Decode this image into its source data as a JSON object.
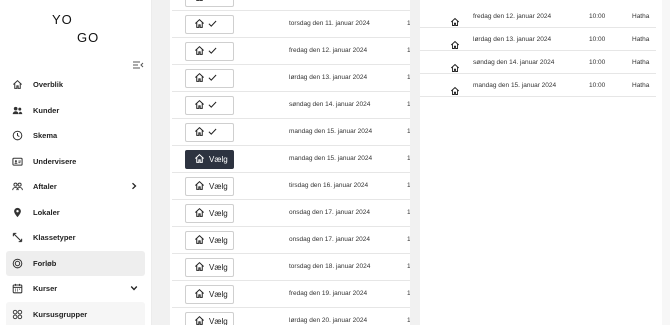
{
  "logo": {
    "line1": "YO",
    "line2": "GO"
  },
  "sidebar": {
    "items": [
      {
        "label": "Overblik",
        "icon": "home-icon"
      },
      {
        "label": "Kunder",
        "icon": "users-icon"
      },
      {
        "label": "Skema",
        "icon": "clock-icon"
      },
      {
        "label": "Undervisere",
        "icon": "id-card-icon"
      },
      {
        "label": "Aftaler",
        "icon": "people-icon",
        "chevron": "right"
      },
      {
        "label": "Lokaler",
        "icon": "location-pin-icon"
      },
      {
        "label": "Klassetyper",
        "icon": "arrows-icon"
      },
      {
        "label": "Forløb",
        "icon": "rings-icon",
        "active": true
      },
      {
        "label": "Kurser",
        "icon": "calendar-icon",
        "chevron": "down"
      },
      {
        "label": "Kursusgrupper",
        "icon": "grid-icon"
      }
    ]
  },
  "table": {
    "rows": [
      {
        "button": "check",
        "label": "",
        "date": "",
        "trail": "1"
      },
      {
        "button": "check",
        "label": "",
        "date": "torsdag den 11. januar 2024",
        "trail": "1"
      },
      {
        "button": "check",
        "label": "",
        "date": "fredag den 12. januar 2024",
        "trail": "1"
      },
      {
        "button": "check",
        "label": "",
        "date": "lørdag den 13. januar 2024",
        "trail": "1"
      },
      {
        "button": "check",
        "label": "",
        "date": "søndag den 14. januar 2024",
        "trail": "1"
      },
      {
        "button": "check",
        "label": "",
        "date": "mandag den 15. januar 2024",
        "trail": "1"
      },
      {
        "button": "dark",
        "label": "Vælg",
        "date": "mandag den 15. januar 2024",
        "trail": "1"
      },
      {
        "button": "select",
        "label": "Vælg",
        "date": "tirsdag den 16. januar 2024",
        "trail": "1"
      },
      {
        "button": "select",
        "label": "Vælg",
        "date": "onsdag den 17. januar 2024",
        "trail": "1"
      },
      {
        "button": "select",
        "label": "Vælg",
        "date": "onsdag den 17. januar 2024",
        "trail": "1"
      },
      {
        "button": "select",
        "label": "Vælg",
        "date": "torsdag den 18. januar 2024",
        "trail": "1"
      },
      {
        "button": "select",
        "label": "Vælg",
        "date": "fredag den 19. januar 2024",
        "trail": "1"
      },
      {
        "button": "select",
        "label": "Vælg",
        "date": "lørdag den 20. januar 2024",
        "trail": "1"
      }
    ]
  },
  "selected": {
    "rows": [
      {
        "date": "fredag den 12. januar 2024",
        "time": "10:00",
        "class": "Hatha"
      },
      {
        "date": "lørdag den 13. januar 2024",
        "time": "10:00",
        "class": "Hatha"
      },
      {
        "date": "søndag den 14. januar 2024",
        "time": "10:00",
        "class": "Hatha"
      },
      {
        "date": "mandag den 15. januar 2024",
        "time": "10:00",
        "class": "Hatha"
      }
    ]
  }
}
